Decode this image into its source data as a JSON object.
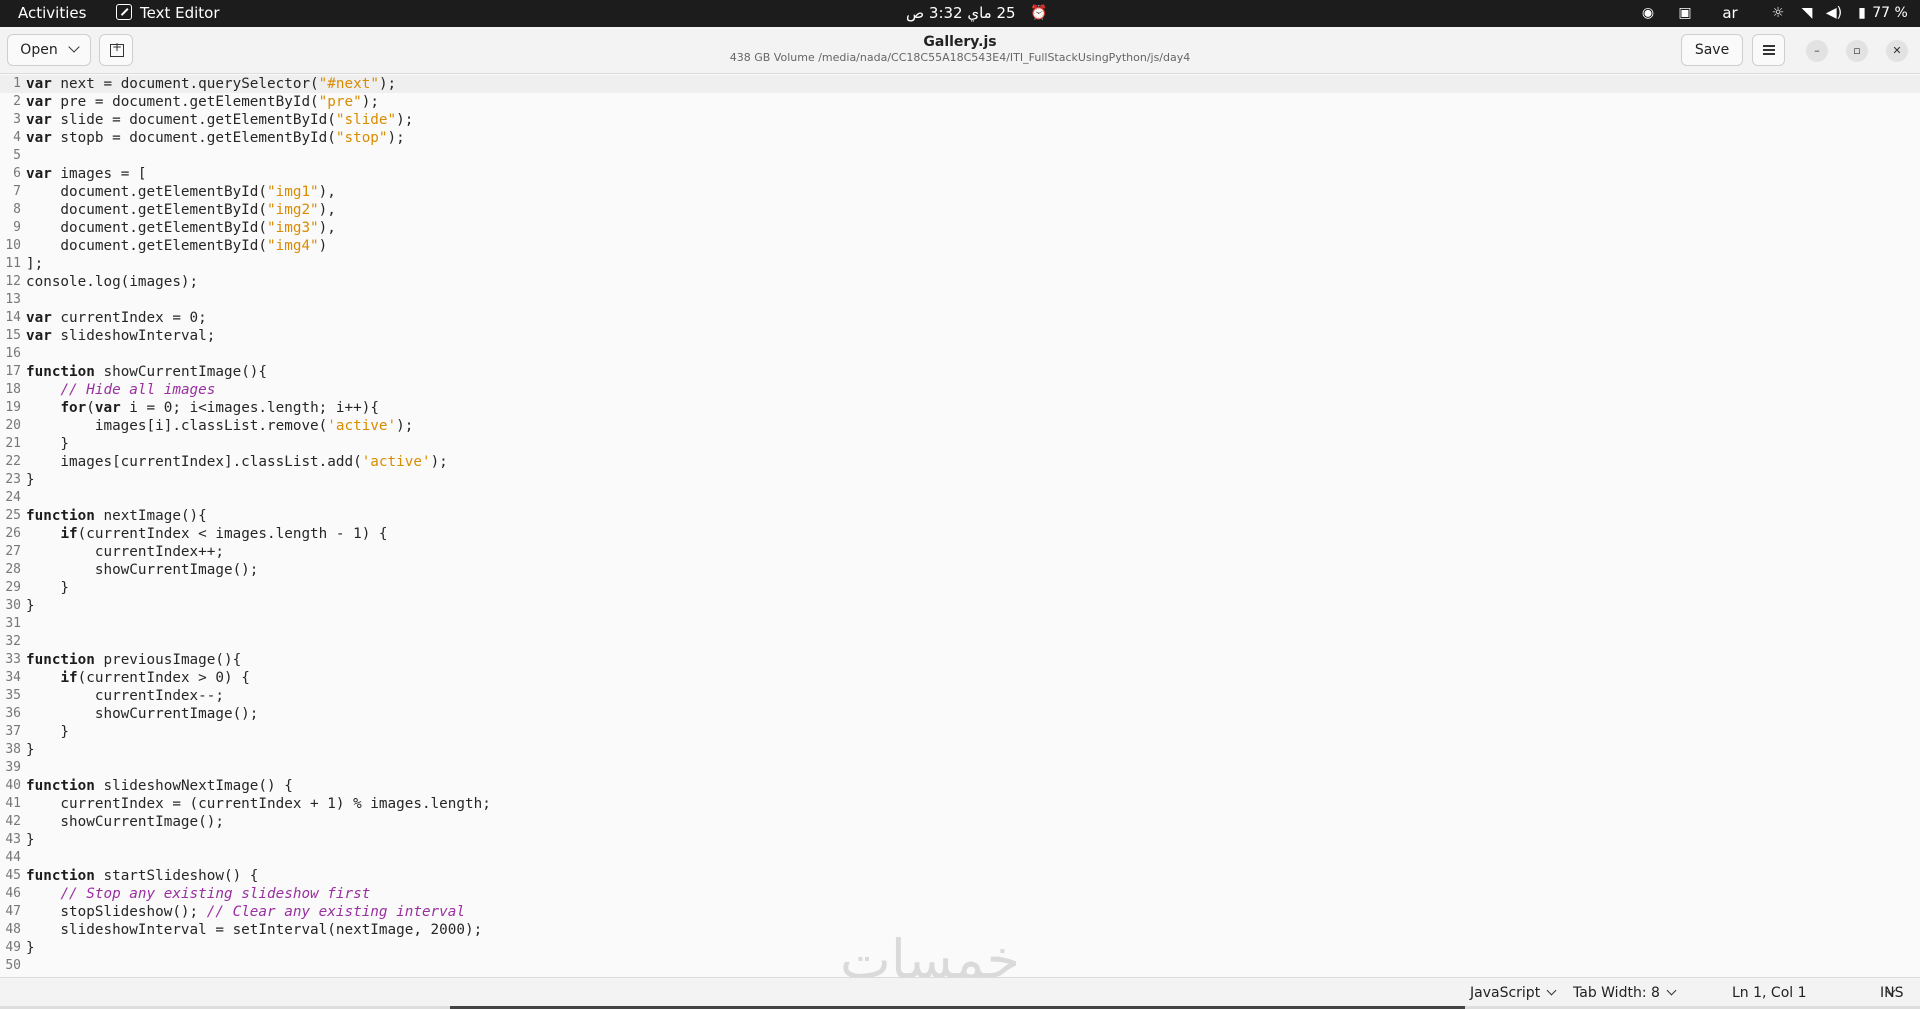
{
  "topbar": {
    "activities": "Activities",
    "app_name": "Text Editor",
    "clock": "25 ماي  3:32 ص",
    "keyboard_layout": "ar",
    "battery": "77 %"
  },
  "header": {
    "open_label": "Open",
    "title": "Gallery.js",
    "path": "438 GB Volume /media/nada/CC18C55A18C543E4/ITI_FullStackUsingPython/js/day4",
    "save_label": "Save"
  },
  "editor": {
    "language": "JavaScript",
    "current_line": 1,
    "lines": [
      "var next = document.querySelector(\"#next\");",
      "var pre = document.getElementById(\"pre\");",
      "var slide = document.getElementById(\"slide\");",
      "var stopb = document.getElementById(\"stop\");",
      "",
      "var images = [",
      "    document.getElementById(\"img1\"),",
      "    document.getElementById(\"img2\"),",
      "    document.getElementById(\"img3\"),",
      "    document.getElementById(\"img4\")",
      "];",
      "console.log(images);",
      "",
      "var currentIndex = 0;",
      "var slideshowInterval;",
      "",
      "function showCurrentImage(){",
      "    // Hide all images",
      "    for(var i = 0; i<images.length; i++){",
      "        images[i].classList.remove('active');",
      "    }",
      "    images[currentIndex].classList.add('active');",
      "}",
      "",
      "function nextImage(){",
      "    if(currentIndex < images.length - 1) {",
      "        currentIndex++;",
      "        showCurrentImage();",
      "    }",
      "}",
      "",
      "",
      "function previousImage(){",
      "    if(currentIndex > 0) {",
      "        currentIndex--;",
      "        showCurrentImage();",
      "    }",
      "}",
      "",
      "function slideshowNextImage() {",
      "    currentIndex = (currentIndex + 1) % images.length;",
      "    showCurrentImage();",
      "}",
      "",
      "function startSlideshow() {",
      "    // Stop any existing slideshow first",
      "    stopSlideshow(); // Clear any existing interval",
      "    slideshowInterval = setInterval(nextImage, 2000);",
      "}",
      ""
    ]
  },
  "watermark": "خمسات",
  "statusbar": {
    "language": "JavaScript",
    "tab_width": "Tab Width: 8",
    "position": "Ln 1, Col 1",
    "mode": "INS"
  },
  "colors": {
    "string": "#d98c00",
    "comment": "#9a2fa0",
    "topbar_bg": "#1c1c1c"
  }
}
